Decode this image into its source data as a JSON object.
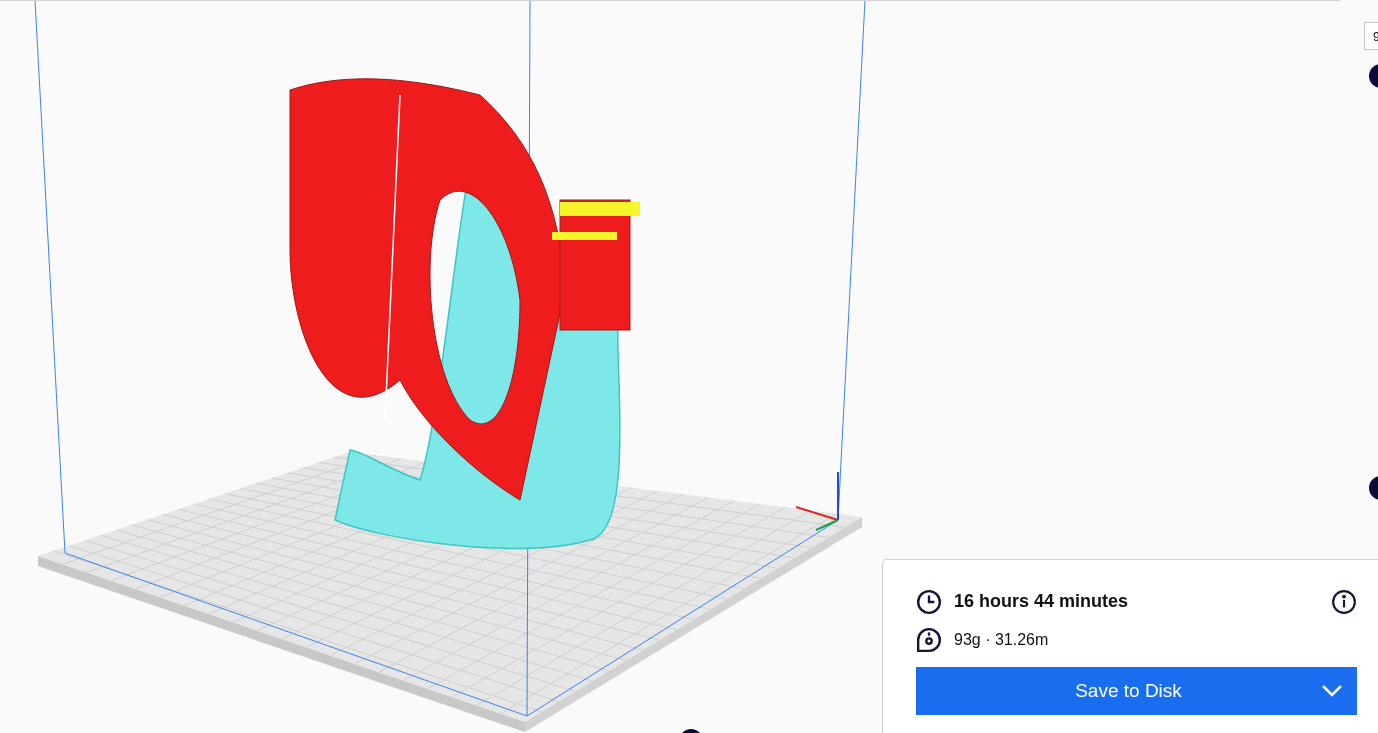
{
  "layer_field": {
    "value": "9"
  },
  "print_info": {
    "duration": "16 hours 44 minutes",
    "material": "93g · 31.26m"
  },
  "save_button": {
    "label": "Save to Disk"
  }
}
